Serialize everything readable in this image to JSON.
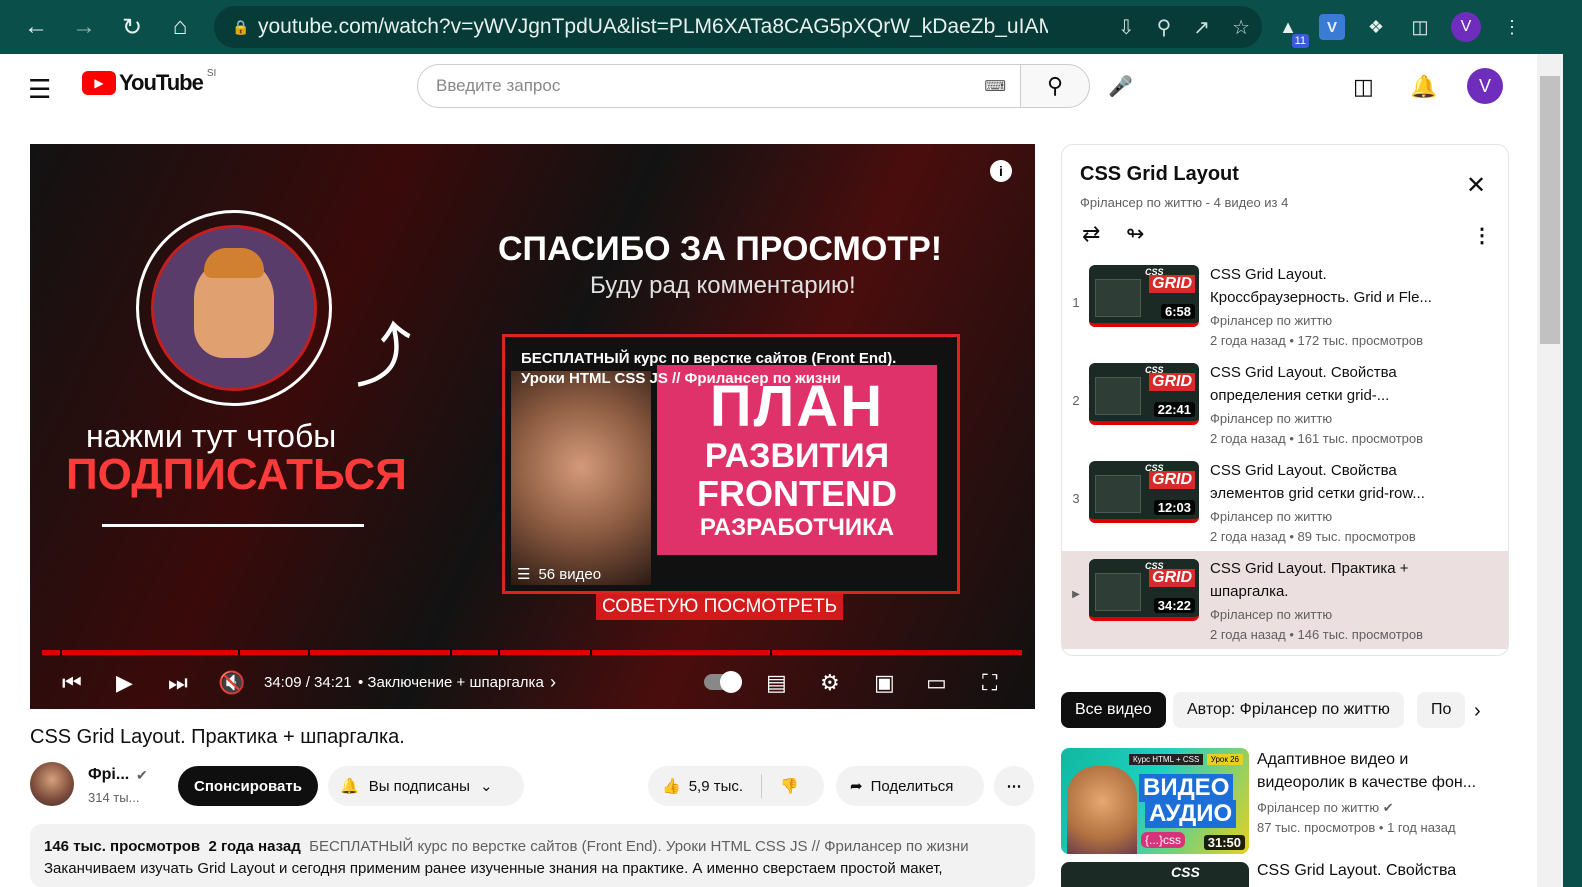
{
  "browser": {
    "url": "youtube.com/watch?v=yWVJgnTpdUA&list=PLM6XATa8CAG5pXQrW_kDaeZb_uIAM...",
    "ext_badge": "11",
    "ext_v": "V",
    "profile_initial": "V"
  },
  "header": {
    "logo_text": "YouTube",
    "region": "SI",
    "search_placeholder": "Введите запрос",
    "avatar_initial": "V"
  },
  "player": {
    "end_title": "СПАСИБО ЗА ПРОСМОТР!",
    "end_subtitle": "Буду рад комментарию!",
    "subscribe_line1": "нажми тут чтобы",
    "subscribe_line2": "ПОДПИСАТЬСЯ",
    "card_title": "БЕСПЛАТНЫЙ курс по верстке сайтов (Front End). Уроки HTML CSS JS // Фрилансер по жизни",
    "card_pink_1": "ПЛАН",
    "card_pink_2": "РАЗВИТИЯ",
    "card_pink_3": "FRONTEND",
    "card_pink_4": "РАЗРАБОТЧИКА",
    "card_count": "56 видео",
    "recommend_label": "СОВЕТУЮ ПОСМОТРЕТЬ",
    "info_icon": "i",
    "timecode": "34:09 / 34:21",
    "chapter": "• Заключение + шпаргалка",
    "progress_fraction": 0.995
  },
  "video": {
    "title": "CSS Grid Layout. Практика + шпаргалка.",
    "channel_name": "Фрі...",
    "channel_subs": "314 ты...",
    "sponsor_label": "Спонсировать",
    "subscribed_label": "Вы подписаны",
    "likes": "5,9 тыс.",
    "share_label": "Поделиться",
    "description": {
      "views": "146 тыс. просмотров",
      "date": "2 года назад",
      "line1": "БЕСПЛАТНЫЙ курс по верстке сайтов (Front End). Уроки HTML CSS JS // Фрилансер по жизни",
      "line2": "Заканчиваем изучать Grid Layout и сегодня применим ранее изученные знания на практике. А именно сверстаем простой макет,"
    }
  },
  "playlist": {
    "title": "CSS Grid Layout",
    "subtitle": "Фрілансер по життю - 4 видео из 4",
    "items": [
      {
        "index": "1",
        "title": "CSS Grid Layout. Кроссбраузерность. Grid и Fle...",
        "channel": "Фрілансер по життю",
        "meta": "2 года назад • 172 тыс. просмотров",
        "duration": "6:58",
        "thumb_label": "GRID",
        "thumb_css": "CSS"
      },
      {
        "index": "2",
        "title": "CSS Grid Layout. Свойства определения сетки grid-...",
        "channel": "Фрілансер по життю",
        "meta": "2 года назад • 161 тыс. просмотров",
        "duration": "22:41",
        "thumb_label": "GRID",
        "thumb_css": "CSS"
      },
      {
        "index": "3",
        "title": "CSS Grid Layout. Свойства элементов grid сетки grid-row...",
        "channel": "Фрілансер по життю",
        "meta": "2 года назад • 89 тыс. просмотров",
        "duration": "12:03",
        "thumb_label": "GRID",
        "thumb_css": "CSS"
      },
      {
        "index": "▶",
        "title": "CSS Grid Layout. Практика + шпаргалка.",
        "channel": "Фрілансер по життю",
        "meta": "2 года назад • 146 тыс. просмотров",
        "duration": "34:22",
        "thumb_label": "GRID",
        "thumb_css": "CSS"
      }
    ]
  },
  "chips": [
    "Все видео",
    "Автор: Фрілансер по життю",
    "По"
  ],
  "recommendations": [
    {
      "title": "Адаптивное видео и видеоролик в качестве фон...",
      "channel": "Фрілансер по життю",
      "meta": "87 тыс. просмотров • 1 год назад",
      "duration": "31:50",
      "big1": "ВИДЕО",
      "big2": "АУДИО",
      "css_label": "{...}css",
      "tag1": "Курс HTML + CSS",
      "tag2": "Урок 26"
    },
    {
      "title": "CSS Grid Layout. Свойства",
      "thumb_css": "CSS"
    }
  ]
}
